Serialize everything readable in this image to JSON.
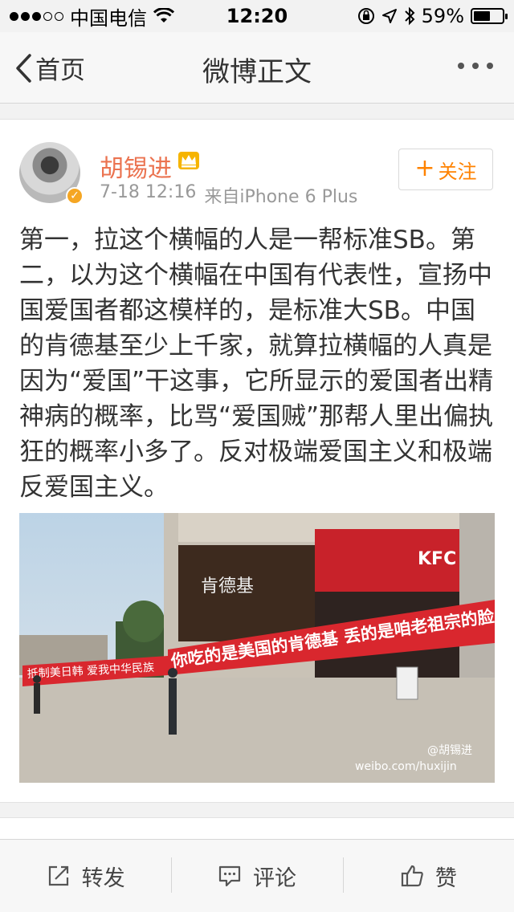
{
  "status_bar": {
    "carrier": "中国电信",
    "time": "12:20",
    "battery": "59%",
    "battery_level": 0.59,
    "signal_bars_filled": 3,
    "signal_bars_total": 5
  },
  "nav": {
    "back_label": "首页",
    "title": "微博正文"
  },
  "post": {
    "author": "胡锡进",
    "date": "7-18 12:16",
    "source": "来自iPhone 6 Plus",
    "follow_label": "关注",
    "text": "第一，拉这个横幅的人是一帮标准SB。第二，以为这个横幅在中国有代表性，宣扬中国爱国者都这模样的，是标准大SB。中国的肯德基至少上千家，就算拉横幅的人真是因为“爱国”干这事，它所显示的爱国者出精神病的概率，比骂“爱国贼”那帮人里出偏执狂的概率小多了。反对极端爱国主义和极端反爱国主义。",
    "image": {
      "store_sign": "肯德基",
      "store_logo": "KFC",
      "banner_left": "抵制美日韩 爱我中华民族",
      "banner_right": "你吃的是美国的肯德基  丢的是咱老祖宗的脸",
      "watermark_handle": "@胡锡进",
      "watermark_url": "weibo.com/huxijin"
    }
  },
  "actions": {
    "repost": "转发",
    "comment": "评论",
    "like": "赞"
  },
  "colors": {
    "accent": "#ff8200",
    "name": "#eb7350",
    "banner": "#d9272e"
  }
}
